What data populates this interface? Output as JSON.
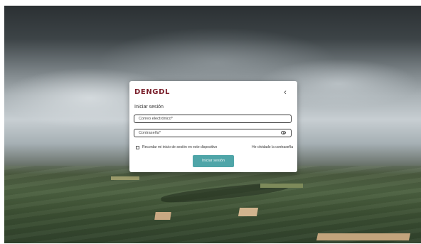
{
  "brand": {
    "logo_text": "DENGDL",
    "logo_color": "#7a1f2b"
  },
  "login": {
    "title": "Iniciar sesión",
    "email_placeholder": "Correo electrónico*",
    "password_placeholder": "Contraseña*",
    "remember_label": "Recordar mi inicio de sesión en este dispositivo",
    "remember_checked": false,
    "forgot_label": "He olvidado la contraseña",
    "submit_label": "Iniciar sesión",
    "accent_color": "#4fa5a8"
  },
  "icons": {
    "back": "chevron-left-icon",
    "toggle_password": "eye-icon"
  }
}
